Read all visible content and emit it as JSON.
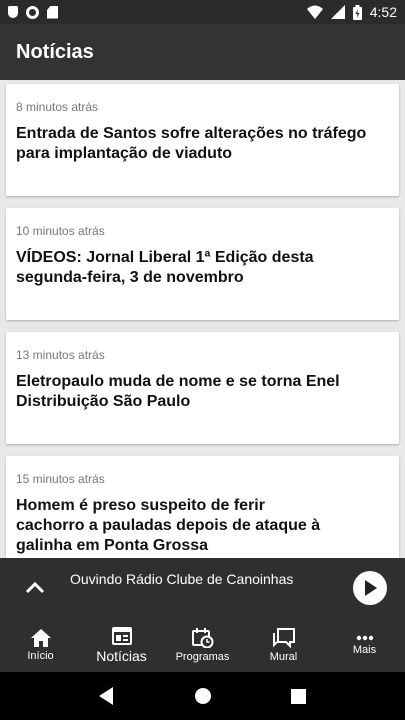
{
  "status_bar": {
    "time": "4:52",
    "icons": [
      "shield-icon",
      "record-icon",
      "sd-card-icon",
      "wifi-icon",
      "signal-icon",
      "battery-icon"
    ]
  },
  "app_bar": {
    "title": "Notícias"
  },
  "news": [
    {
      "time": "8 minutos atrás",
      "title": "Entrada de Santos sofre alterações no tráfego para implantação de viaduto"
    },
    {
      "time": "10 minutos atrás",
      "title": "VÍDEOS: Jornal Liberal 1ª Edição desta segunda-feira, 3 de novembro"
    },
    {
      "time": "13 minutos atrás",
      "title": "Eletropaulo muda de nome e se torna Enel Distribuição São Paulo"
    },
    {
      "time": "15 minutos atrás",
      "title": "Homem é preso suspeito de ferir cachorro a pauladas depois de ataque à galinha em Ponta Grossa"
    }
  ],
  "player": {
    "label": "Ouvindo Rádio Clube de Canoinhas"
  },
  "bottom_nav": [
    {
      "label": "Início",
      "icon": "home-icon"
    },
    {
      "label": "Notícias",
      "icon": "news-icon",
      "active": true
    },
    {
      "label": "Programas",
      "icon": "schedule-icon"
    },
    {
      "label": "Mural",
      "icon": "chat-icon"
    },
    {
      "label": "Mais",
      "icon": "more-icon"
    }
  ],
  "colors": {
    "app_bar": "#333333",
    "status_bar": "#2b2b2b",
    "background": "#e8e8e8",
    "card": "#ffffff"
  }
}
